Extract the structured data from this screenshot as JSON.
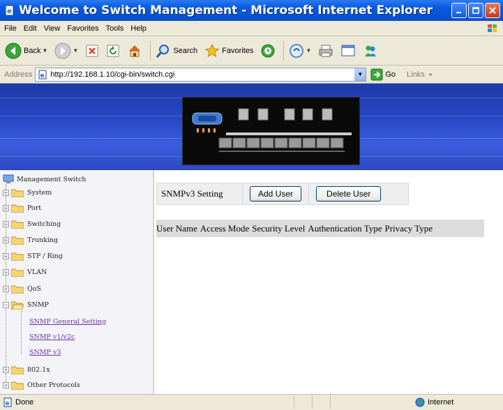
{
  "window": {
    "title": "Welcome to Switch Management - Microsoft Internet Explorer"
  },
  "menu": [
    "File",
    "Edit",
    "View",
    "Favorites",
    "Tools",
    "Help"
  ],
  "toolbar": {
    "back_label": "Back",
    "search_label": "Search",
    "favorites_label": "Favorites"
  },
  "address": {
    "label": "Address",
    "url": "http://192.168.1.10/cgi-bin/switch.cgi",
    "go_label": "Go",
    "links_label": "Links"
  },
  "sidebar": {
    "root_label": "Management Switch",
    "items": [
      {
        "label": "System",
        "expander": "+"
      },
      {
        "label": "Port",
        "expander": "+"
      },
      {
        "label": "Switching",
        "expander": "+"
      },
      {
        "label": "Trunking",
        "expander": "+"
      },
      {
        "label": "STP / Ring",
        "expander": "+"
      },
      {
        "label": "VLAN",
        "expander": "+"
      },
      {
        "label": "QoS",
        "expander": "+"
      },
      {
        "label": "SNMP",
        "expander": "−"
      },
      {
        "label": "802.1x",
        "expander": "+"
      },
      {
        "label": "Other Protocols",
        "expander": "+"
      }
    ],
    "snmp_children": [
      "SNMP General Setting",
      "SNMP v1/v2c",
      "SNMP v3"
    ]
  },
  "main": {
    "heading": "SNMPv3 Setting",
    "add_user_label": "Add User",
    "delete_user_label": "Delete User",
    "columns": [
      "User Name",
      "Access Mode",
      "Security Level",
      "Authentication Type",
      "Privacy Type"
    ]
  },
  "status": {
    "text": "Done",
    "zone": "Internet"
  },
  "colors": {
    "titlebar": "#0a5ae0",
    "banner": "#2747c4",
    "link_visited": "#6633aa"
  }
}
